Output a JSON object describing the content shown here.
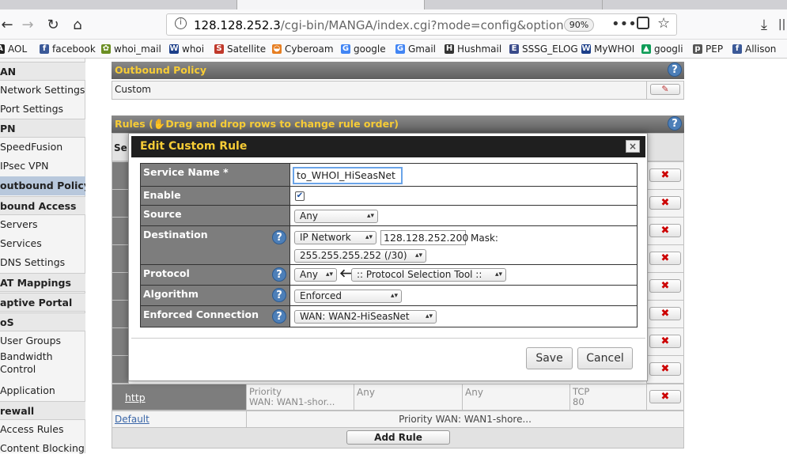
{
  "browser": {
    "url_host": "128.128.252.3",
    "url_path": "/cgi-bin/MANGA/index.cgi?mode=config&option",
    "zoom": "90%"
  },
  "bookmarks": [
    {
      "label": "AOL",
      "icon": "aol-icon",
      "color": "#222222"
    },
    {
      "label": "facebook",
      "icon": "facebook-icon",
      "color": "#3b5998"
    },
    {
      "label": "whoi_mail",
      "icon": "gear-icon",
      "color": "#6b8e23"
    },
    {
      "label": "whoi",
      "icon": "whoi-icon",
      "color": "#1c3f8a"
    },
    {
      "label": "Satellite",
      "icon": "satellite-icon",
      "color": "#c0392b"
    },
    {
      "label": "Cyberoam",
      "icon": "cyberoam-icon",
      "color": "#e67e22"
    },
    {
      "label": "google",
      "icon": "google-icon",
      "color": "#4285f4"
    },
    {
      "label": "Gmail",
      "icon": "google-icon",
      "color": "#4285f4"
    },
    {
      "label": "Hushmail",
      "icon": "hushmail-icon",
      "color": "#333333"
    },
    {
      "label": "SSSG_ELOG",
      "icon": "elog-icon",
      "color": "#3a4b8a"
    },
    {
      "label": "MyWHOI",
      "icon": "whoi-icon",
      "color": "#1c3f8a"
    },
    {
      "label": "googli",
      "icon": "drive-icon",
      "color": "#0f9d58"
    },
    {
      "label": "PEP",
      "icon": "pep-icon",
      "color": "#555555"
    },
    {
      "label": "Allison",
      "icon": "facebook-icon",
      "color": "#3b5998"
    }
  ],
  "sidebar": {
    "items": [
      {
        "label": "AN",
        "type": "sec"
      },
      {
        "label": "Network Settings",
        "type": "item"
      },
      {
        "label": "Port Settings",
        "type": "item"
      },
      {
        "label": "PN",
        "type": "sec"
      },
      {
        "label": "SpeedFusion",
        "type": "item"
      },
      {
        "label": "IPsec VPN",
        "type": "item"
      },
      {
        "label": "outbound Policy",
        "type": "active"
      },
      {
        "label": "bound Access",
        "type": "sec"
      },
      {
        "label": "Servers",
        "type": "item"
      },
      {
        "label": "Services",
        "type": "item"
      },
      {
        "label": "DNS Settings",
        "type": "item"
      },
      {
        "label": "AT Mappings",
        "type": "sec"
      },
      {
        "label": "aptive Portal",
        "type": "sec"
      },
      {
        "label": "oS",
        "type": "sec"
      },
      {
        "label": "User Groups",
        "type": "item"
      },
      {
        "label": "Bandwidth",
        "type": "item2"
      },
      {
        "label": "Control",
        "type": "item2b"
      },
      {
        "label": "Application",
        "type": "item"
      },
      {
        "label": "rewall",
        "type": "sec"
      },
      {
        "label": "Access Rules",
        "type": "item"
      },
      {
        "label": "Content Blocking",
        "type": "item"
      }
    ]
  },
  "outbound_policy": {
    "title": "Outbound Policy",
    "value": "Custom"
  },
  "rules": {
    "title": "Rules",
    "hint": "Drag and drop rows to change rule order)",
    "col_header": "Se",
    "http_row": {
      "name": "http",
      "algorithm": "Priority",
      "algorithm_detail": "WAN: WAN1-shor...",
      "source": "Any",
      "destination": "Any",
      "protocol": "TCP",
      "port": "80"
    },
    "default_row": {
      "name": "Default",
      "detail": "Priority WAN: WAN1-shore..."
    },
    "add_rule": "Add Rule"
  },
  "modal": {
    "title": "Edit Custom Rule",
    "close": "×",
    "fields": {
      "service_name_label": "Service Name *",
      "service_name_value": "to_WHOI_HiSeasNet",
      "enable_label": "Enable",
      "source_label": "Source",
      "source_value": "Any",
      "destination_label": "Destination",
      "destination_type": "IP Network",
      "destination_ip": "128.128.252.200",
      "mask_label": "Mask:",
      "mask_value": "255.255.255.252 (/30)",
      "protocol_label": "Protocol",
      "protocol_value": "Any",
      "protocol_tool": ":: Protocol Selection Tool ::",
      "algorithm_label": "Algorithm",
      "algorithm_value": "Enforced",
      "enforced_label": "Enforced Connection",
      "enforced_value": "WAN: WAN2-HiSeasNet"
    },
    "save": "Save",
    "cancel": "Cancel"
  },
  "colors": {
    "header_text": "#f7cc36",
    "header_bg": "#6e6e6e",
    "delete": "#cc0000",
    "help": "#4d7fb8"
  }
}
